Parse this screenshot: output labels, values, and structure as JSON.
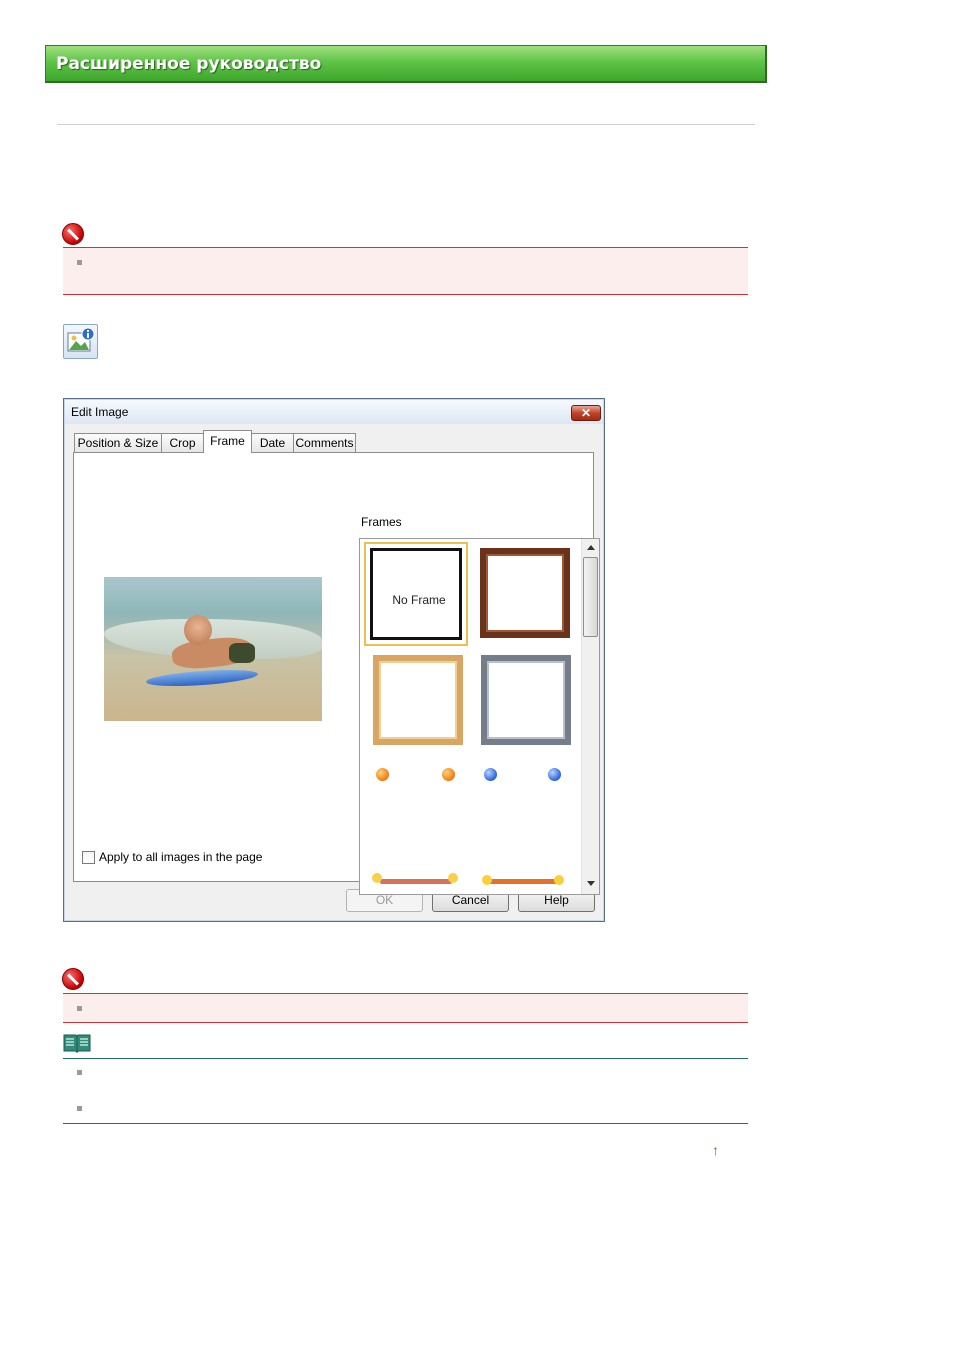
{
  "header": {
    "title": "Расширенное руководство"
  },
  "dialog": {
    "title": "Edit Image",
    "close_label": "✕",
    "tabs": [
      {
        "label": "Position & Size"
      },
      {
        "label": "Crop"
      },
      {
        "label": "Frame"
      },
      {
        "label": "Date"
      },
      {
        "label": "Comments"
      }
    ],
    "active_tab": "Frame",
    "frames_label": "Frames",
    "no_frame_label": "No Frame",
    "apply_all_label": "Apply to all images in the page",
    "buttons": {
      "ok": "OK",
      "cancel": "Cancel",
      "help": "Help"
    }
  },
  "back_to_top_icon": "↑",
  "colors": {
    "banner": "#4cb63a",
    "important": "#c8353a",
    "hint": "#1f6e6b"
  }
}
